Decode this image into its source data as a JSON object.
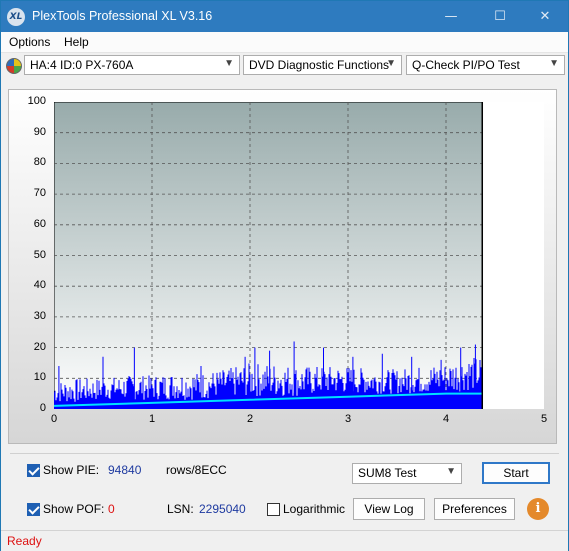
{
  "window": {
    "title": "PlexTools Professional XL V3.16",
    "icon_text": "XL",
    "controls": {
      "minimize": "—",
      "maximize": "☐",
      "close": "✕"
    }
  },
  "menu": {
    "options": "Options",
    "help": "Help"
  },
  "toolbar": {
    "drive": "HA:4 ID:0  PX-760A",
    "function": "DVD Diagnostic Functions",
    "test": "Q-Check PI/PO Test"
  },
  "chart_data": {
    "type": "line",
    "xlim": [
      0,
      5
    ],
    "ylim": [
      0,
      100
    ],
    "x_ticks": [
      "0",
      "1",
      "2",
      "3",
      "4",
      "5"
    ],
    "y_ticks": [
      "0",
      "10",
      "20",
      "30",
      "40",
      "50",
      "60",
      "70",
      "80",
      "90",
      "100"
    ],
    "grid": true,
    "end_marker_x": 4.37,
    "series": [
      {
        "color": "#0000ff",
        "x": [
          0,
          0.25,
          0.5,
          0.75,
          1.0,
          1.25,
          1.5,
          1.75,
          2.0,
          2.25,
          2.5,
          2.75,
          3.0,
          3.25,
          3.5,
          3.75,
          4.0,
          4.2,
          4.37
        ],
        "y_low": [
          2,
          2,
          3,
          3,
          3,
          3,
          3,
          4,
          4,
          4,
          4,
          5,
          5,
          5,
          5,
          5,
          5,
          6,
          6
        ],
        "y_high": [
          9,
          10,
          10,
          11,
          11,
          12,
          12,
          13,
          15,
          15,
          14,
          14,
          14,
          13,
          13,
          14,
          15,
          17,
          17
        ],
        "spikes": [
          [
            0.05,
            14
          ],
          [
            0.5,
            17
          ],
          [
            0.82,
            20
          ],
          [
            1.5,
            14
          ],
          [
            1.95,
            17
          ],
          [
            2.05,
            20
          ],
          [
            2.2,
            19
          ],
          [
            2.45,
            22
          ],
          [
            2.75,
            20
          ],
          [
            3.05,
            17
          ],
          [
            3.35,
            18
          ],
          [
            3.65,
            17
          ],
          [
            3.95,
            16
          ],
          [
            4.15,
            20
          ],
          [
            4.3,
            21
          ]
        ]
      },
      {
        "color": "#00e0ff",
        "x": [
          0,
          1,
          2,
          3,
          4,
          4.37
        ],
        "y": [
          1,
          2,
          3,
          4,
          5,
          5
        ]
      }
    ]
  },
  "bottom": {
    "show_pie_label": "Show PIE:",
    "pie_value": "94840",
    "rows_label": "rows/8ECC",
    "show_pof_label": "Show POF:",
    "pof_value": "0",
    "lsn_label": "LSN:",
    "lsn_value": "2295040",
    "logarithmic_label": "Logarithmic",
    "sum_test": "SUM8 Test",
    "start_label": "Start",
    "view_log_label": "View Log",
    "preferences_label": "Preferences",
    "info_icon": "i"
  },
  "status": {
    "text": "Ready"
  }
}
